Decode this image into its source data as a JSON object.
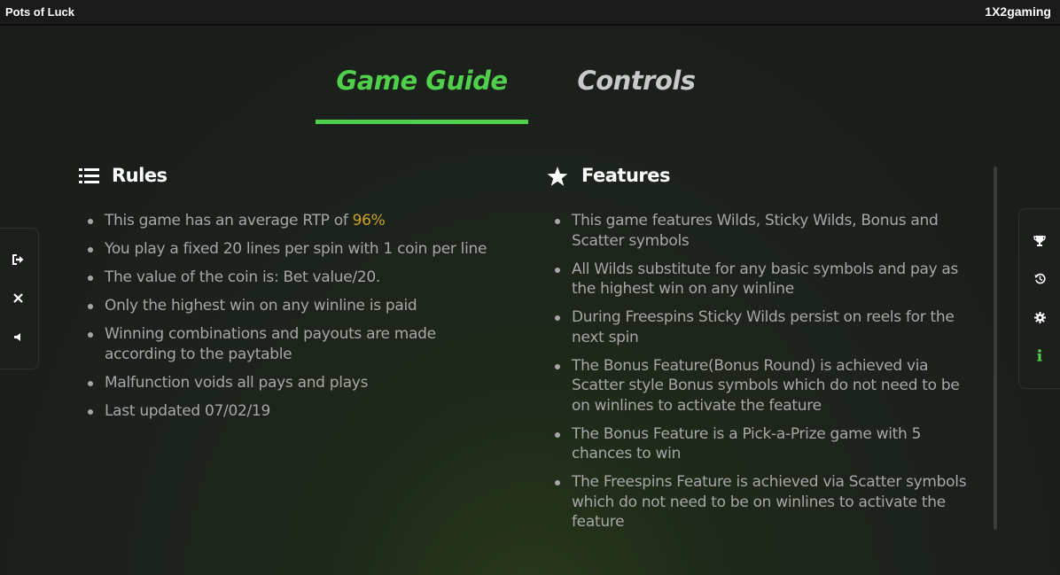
{
  "header": {
    "game_title": "Pots of Luck",
    "brand": "1X2gaming"
  },
  "tabs": [
    {
      "label": "Game Guide",
      "active": true
    },
    {
      "label": "Controls",
      "active": false
    }
  ],
  "rules": {
    "title": "Rules",
    "icon": "list-icon",
    "rtp_prefix": "This game has an average RTP of ",
    "rtp_value": "96%",
    "items": [
      "You play a fixed 20 lines per spin with 1 coin per line",
      "The value of the coin is: Bet value/20.",
      "Only the highest win on any winline is paid",
      "Winning combinations and payouts are made according to the paytable",
      "Malfunction voids all pays and plays",
      "Last updated 07/02/19"
    ]
  },
  "features": {
    "title": "Features",
    "icon": "star-icon",
    "items": [
      "This game features Wilds, Sticky Wilds, Bonus and Scatter symbols",
      "All Wilds substitute for any basic symbols and pay as the highest win on any winline",
      "During Freespins Sticky Wilds persist on reels for the next spin",
      "The Bonus Feature(Bonus Round) is achieved via Scatter style Bonus symbols which do not need to be on winlines to activate the feature",
      "The Bonus Feature is a Pick-a-Prize game with 5 chances to win",
      "The Freespins Feature is achieved via Scatter symbols which do not need to be on winlines to activate the feature"
    ]
  },
  "left_controls": [
    "exit-icon",
    "close-icon",
    "sound-icon"
  ],
  "right_controls": [
    "trophy-icon",
    "history-icon",
    "settings-icon",
    "info-icon"
  ],
  "colors": {
    "accent_green": "#4fcf4a",
    "rtp_gold": "#c9a227",
    "text_gray": "#a7a7a7"
  }
}
